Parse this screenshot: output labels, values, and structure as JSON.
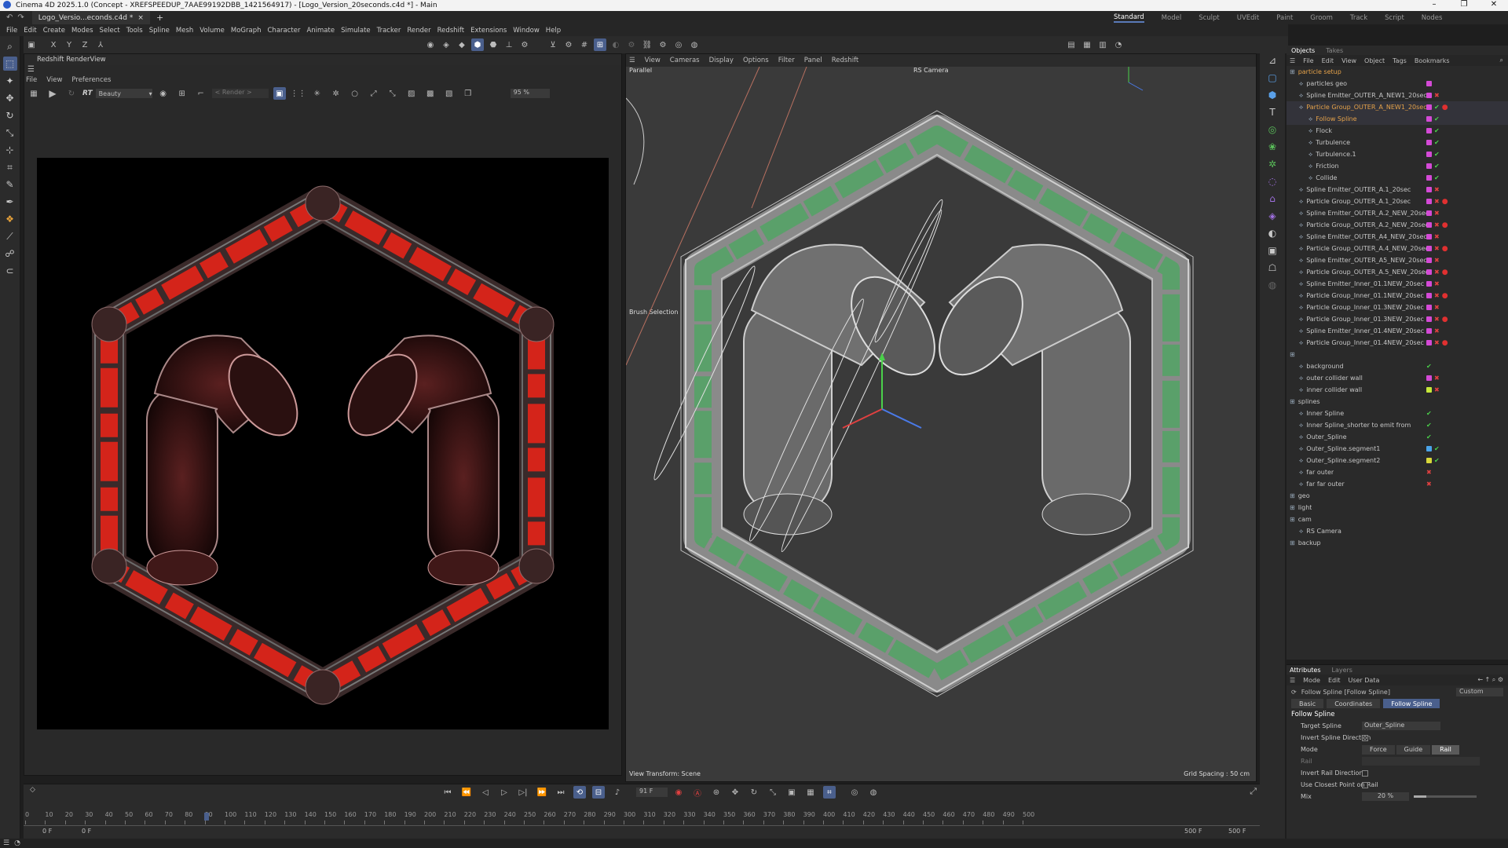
{
  "window": {
    "title": "Cinema 4D 2025.1.0 (Concept - XREFSPEEDUP_7AAE99192DBB_1421564917) - [Logo_Version_20seconds.c4d *] - Main",
    "controls": [
      "–",
      "❐",
      "✕"
    ]
  },
  "doc_tab": {
    "label": "Logo_Versio...econds.c4d *",
    "close": "×",
    "new": "+"
  },
  "layouts": [
    "Standard",
    "Model",
    "Sculpt",
    "UVEdit",
    "Paint",
    "Groom",
    "Track",
    "Script",
    "Nodes"
  ],
  "menu": [
    "File",
    "Edit",
    "Create",
    "Modes",
    "Select",
    "Tools",
    "Spline",
    "Mesh",
    "Volume",
    "MoGraph",
    "Character",
    "Animate",
    "Simulate",
    "Tracker",
    "Render",
    "Redshift",
    "Extensions",
    "Window",
    "Help"
  ],
  "toolbar_axes": [
    "X",
    "Y",
    "Z"
  ],
  "renderview": {
    "title": "Redshift RenderView",
    "menu": [
      "File",
      "View",
      "Preferences"
    ],
    "rt_label": "RT",
    "aov": "Beauty",
    "render_dropdown": "< Render >",
    "zoom": "95 %"
  },
  "viewport": {
    "menu": [
      "View",
      "Cameras",
      "Display",
      "Options",
      "Filter",
      "Panel",
      "Redshift"
    ],
    "projection": "Parallel",
    "camera": "RS Camera",
    "brush_label": "Brush Selection",
    "view_transform": "View Transform: Scene",
    "grid_spacing": "Grid Spacing : 50 cm"
  },
  "objmgr": {
    "tabs": [
      "Objects",
      "Takes"
    ],
    "menu": [
      "File",
      "Edit",
      "View",
      "Object",
      "Tags",
      "Bookmarks"
    ],
    "rows": [
      {
        "name": "particle setup",
        "indent": 0,
        "swatch": "",
        "check": "",
        "orange": true
      },
      {
        "name": "particles geo",
        "indent": 1,
        "swatch": "#d44ad6",
        "check": ""
      },
      {
        "name": "Spline Emitter_OUTER_A_NEW1_20sec",
        "indent": 1,
        "swatch": "#d44ad6",
        "check": "x"
      },
      {
        "name": "Particle Group_OUTER_A_NEW1_20sec",
        "indent": 1,
        "swatch": "#d44ad6",
        "check": "v",
        "sel": true,
        "sphere": true
      },
      {
        "name": "Follow Spline",
        "indent": 2,
        "swatch": "#d44ad6",
        "check": "v",
        "sel": true
      },
      {
        "name": "Flock",
        "indent": 2,
        "swatch": "#d44ad6",
        "check": "v"
      },
      {
        "name": "Turbulence",
        "indent": 2,
        "swatch": "#d44ad6",
        "check": "v"
      },
      {
        "name": "Turbulence.1",
        "indent": 2,
        "swatch": "#d44ad6",
        "check": "v"
      },
      {
        "name": "Friction",
        "indent": 2,
        "swatch": "#d44ad6",
        "check": "v"
      },
      {
        "name": "Collide",
        "indent": 2,
        "swatch": "#d44ad6",
        "check": "v"
      },
      {
        "name": "Spline Emitter_OUTER_A.1_20sec",
        "indent": 1,
        "swatch": "#d44ad6",
        "check": "x"
      },
      {
        "name": "Particle Group_OUTER_A.1_20sec",
        "indent": 1,
        "swatch": "#d44ad6",
        "check": "x",
        "sphere": true
      },
      {
        "name": "Spline Emitter_OUTER_A.2_NEW_20sec",
        "indent": 1,
        "swatch": "#d44ad6",
        "check": "x"
      },
      {
        "name": "Particle Group_OUTER_A.2_NEW_20sec",
        "indent": 1,
        "swatch": "#d44ad6",
        "check": "x",
        "sphere": true
      },
      {
        "name": "Spline Emitter_OUTER_A4_NEW_20sec",
        "indent": 1,
        "swatch": "#d44ad6",
        "check": "x"
      },
      {
        "name": "Particle Group_OUTER_A.4_NEW_20sec",
        "indent": 1,
        "swatch": "#d44ad6",
        "check": "x",
        "sphere": true
      },
      {
        "name": "Spline Emitter_OUTER_A5_NEW_20sec",
        "indent": 1,
        "swatch": "#d44ad6",
        "check": "x"
      },
      {
        "name": "Particle Group_OUTER_A.5_NEW_20sec",
        "indent": 1,
        "swatch": "#d44ad6",
        "check": "x",
        "sphere": true
      },
      {
        "name": "Spline Emitter_Inner_01.1NEW_20sec",
        "indent": 1,
        "swatch": "#d44ad6",
        "check": "x"
      },
      {
        "name": "Particle Group_Inner_01.1NEW_20sec",
        "indent": 1,
        "swatch": "#d44ad6",
        "check": "x",
        "sphere": true
      },
      {
        "name": "Particle Group_Inner_01.3NEW_20sec",
        "indent": 1,
        "swatch": "#d44ad6",
        "check": "x"
      },
      {
        "name": "Particle Group_Inner_01.3NEW_20sec",
        "indent": 1,
        "swatch": "#d44ad6",
        "check": "x",
        "sphere": true
      },
      {
        "name": "Spline Emitter_Inner_01.4NEW_20sec",
        "indent": 1,
        "swatch": "#d44ad6",
        "check": "x"
      },
      {
        "name": "Particle Group_Inner_01.4NEW_20sec",
        "indent": 1,
        "swatch": "#d44ad6",
        "check": "x",
        "sphere": true
      },
      {
        "name": "",
        "indent": 0,
        "swatch": "",
        "check": ""
      },
      {
        "name": "background",
        "indent": 1,
        "swatch": "",
        "check": "v"
      },
      {
        "name": "outer collider wall",
        "indent": 1,
        "swatch": "#d44ad6",
        "check": "x"
      },
      {
        "name": "inner collider wall",
        "indent": 1,
        "swatch": "#c6e83a",
        "check": "x"
      },
      {
        "name": "splines",
        "indent": 0,
        "swatch": "",
        "check": ""
      },
      {
        "name": "Inner Spline",
        "indent": 1,
        "swatch": "",
        "check": "v"
      },
      {
        "name": "Inner Spline_shorter to emit from",
        "indent": 1,
        "swatch": "",
        "check": "v"
      },
      {
        "name": "Outer_Spline",
        "indent": 1,
        "swatch": "",
        "check": "v"
      },
      {
        "name": "Outer_Spline.segment1",
        "indent": 1,
        "swatch": "#4aa4e8",
        "check": "v"
      },
      {
        "name": "Outer_Spline.segment2",
        "indent": 1,
        "swatch": "#d8d83a",
        "check": "v"
      },
      {
        "name": "far outer",
        "indent": 1,
        "swatch": "",
        "check": "x"
      },
      {
        "name": "far far outer",
        "indent": 1,
        "swatch": "",
        "check": "x"
      },
      {
        "name": "geo",
        "indent": 0,
        "swatch": "",
        "check": ""
      },
      {
        "name": "light",
        "indent": 0,
        "swatch": "",
        "check": ""
      },
      {
        "name": "cam",
        "indent": 0,
        "swatch": "",
        "check": ""
      },
      {
        "name": "RS Camera",
        "indent": 1,
        "swatch": "",
        "check": ""
      },
      {
        "name": "backup",
        "indent": 0,
        "swatch": "",
        "check": ""
      }
    ]
  },
  "attributes": {
    "tabs": [
      "Attributes",
      "Layers"
    ],
    "menu": [
      "Mode",
      "Edit",
      "User Data"
    ],
    "object_label": "Follow Spline [Follow Spline]",
    "preset": "Custom",
    "subtabs": [
      "Basic",
      "Coordinates",
      "Follow Spline"
    ],
    "section": "Follow Spline",
    "target_spline_label": "Target Spline",
    "target_spline_value": "Outer_Spline",
    "invert_spline_direction": "Invert Spline Direction",
    "mode_label": "Mode",
    "mode_options": [
      "Force",
      "Guide",
      "Rail"
    ],
    "rail_label": "Rail",
    "invert_rail_direction": "Invert Rail Direction",
    "use_closest_point": "Use Closest Point on Rail",
    "mix_label": "Mix",
    "mix_value": "20 %",
    "mix_fraction": 0.2
  },
  "timeline": {
    "current_frame": "91 F",
    "start_a": "0 F",
    "start_b": "0 F",
    "end_a": "500 F",
    "end_b": "500 F",
    "ticks": [
      "0",
      "10",
      "20",
      "30",
      "40",
      "50",
      "60",
      "70",
      "80",
      "90",
      "100",
      "110",
      "120",
      "130",
      "140",
      "150",
      "160",
      "170",
      "180",
      "190",
      "200",
      "210",
      "220",
      "230",
      "240",
      "250",
      "260",
      "270",
      "280",
      "290",
      "300",
      "310",
      "320",
      "330",
      "340",
      "350",
      "360",
      "370",
      "380",
      "390",
      "400",
      "410",
      "420",
      "430",
      "440",
      "450",
      "460",
      "470",
      "480",
      "490",
      "500"
    ],
    "playhead_frame": 91,
    "max_frame": 500
  },
  "colors": {
    "accent": "#4a5f8c",
    "selected_text": "#e5a24a",
    "particle_render": "#e8261c",
    "particle_viewport": "#5aa06a"
  }
}
